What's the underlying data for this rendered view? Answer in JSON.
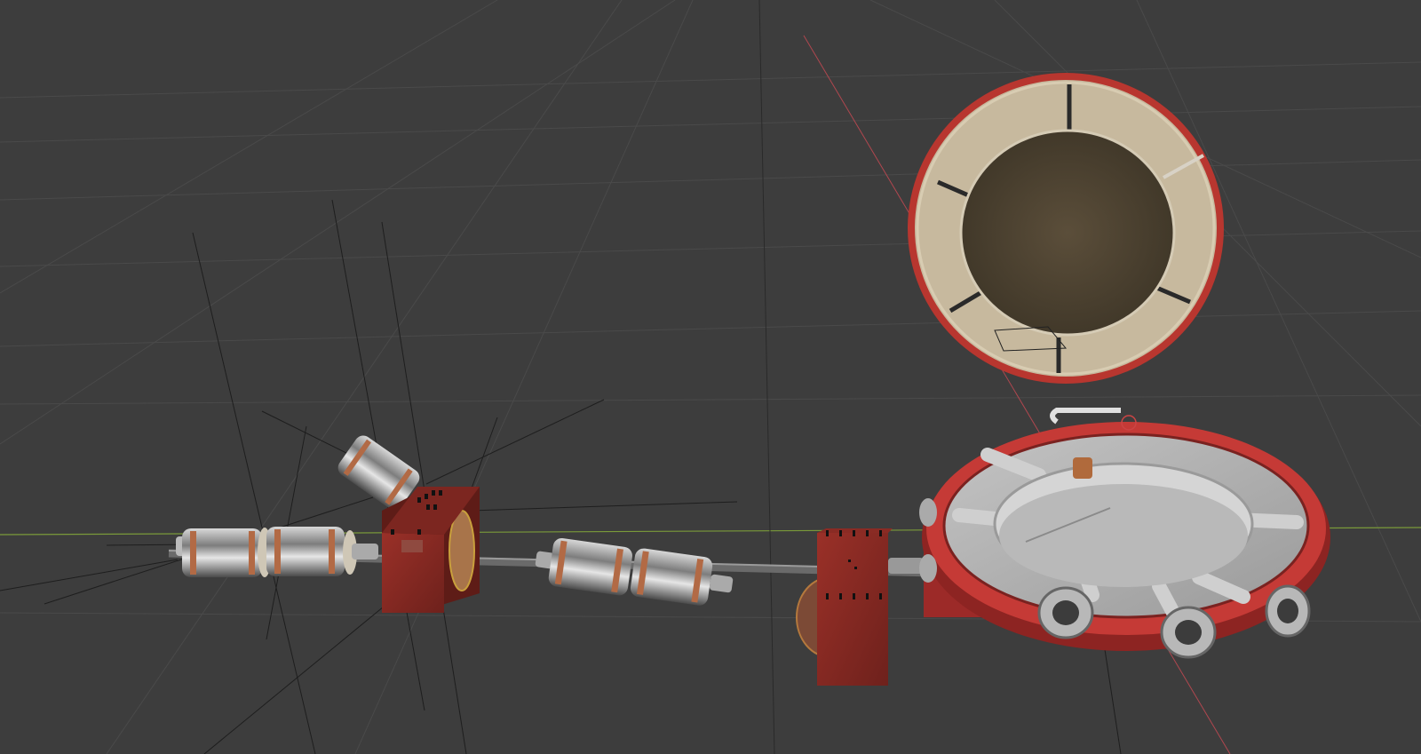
{
  "viewport": {
    "background": "#3d3d3d",
    "grid_color": "#4a4a4a",
    "x_axis_color": "#7a9a3a",
    "y_axis_color": "#b0474f"
  },
  "objects": [
    {
      "name": "magnet-coil-1",
      "material": "chrome-copper"
    },
    {
      "name": "magnet-coil-2",
      "material": "chrome-copper"
    },
    {
      "name": "dipole-magnet-1",
      "material": "red-steel"
    },
    {
      "name": "angled-coil",
      "material": "chrome-copper"
    },
    {
      "name": "magnet-coil-3",
      "material": "chrome-copper"
    },
    {
      "name": "magnet-coil-4",
      "material": "chrome-copper"
    },
    {
      "name": "dipole-magnet-2",
      "material": "red-steel"
    },
    {
      "name": "target-chamber",
      "material": "red-steel"
    },
    {
      "name": "chamber-lid",
      "material": "red-steel"
    }
  ]
}
